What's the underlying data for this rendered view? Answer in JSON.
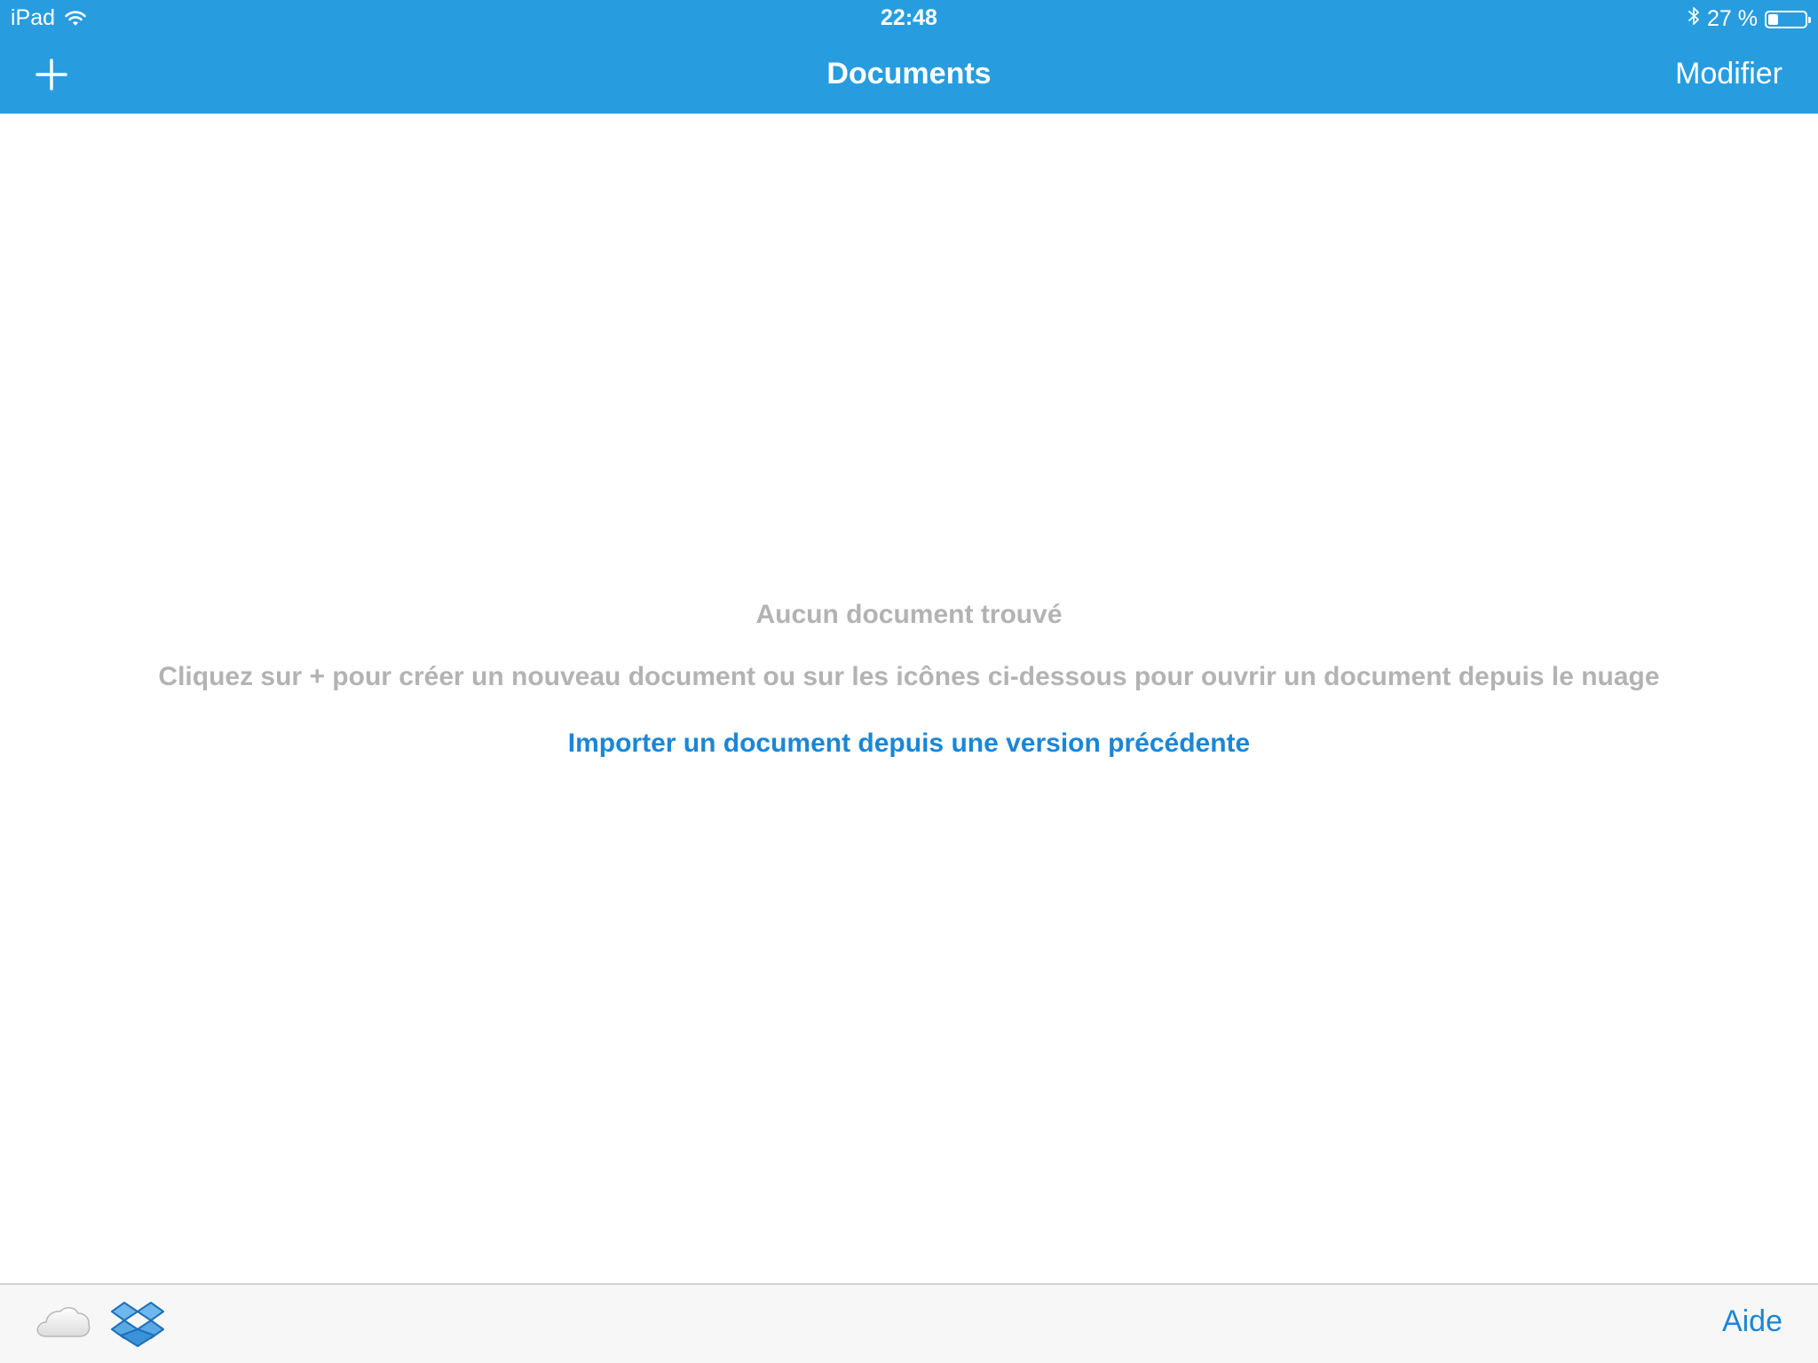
{
  "status_bar": {
    "device": "iPad",
    "time": "22:48",
    "battery_text": "27 %",
    "battery_level": 0.27,
    "icons": [
      "wifi-icon",
      "bluetooth-icon",
      "battery-icon"
    ]
  },
  "nav_bar": {
    "title": "Documents",
    "edit_label": "Modifier",
    "add_icon": "plus-icon"
  },
  "empty_state": {
    "title": "Aucun document trouvé",
    "description": "Cliquez sur + pour créer un nouveau document ou sur les icônes ci-dessous pour ouvrir un document depuis le nuage",
    "import_link": "Importer un document depuis une version précédente"
  },
  "toolbar": {
    "icons": [
      "icloud-icon",
      "dropbox-icon"
    ],
    "help_label": "Aide"
  },
  "colors": {
    "accent": "#279ddf",
    "link": "#1b86d6",
    "muted_text": "#b3b3b3",
    "toolbar_bg": "#f7f7f7"
  }
}
